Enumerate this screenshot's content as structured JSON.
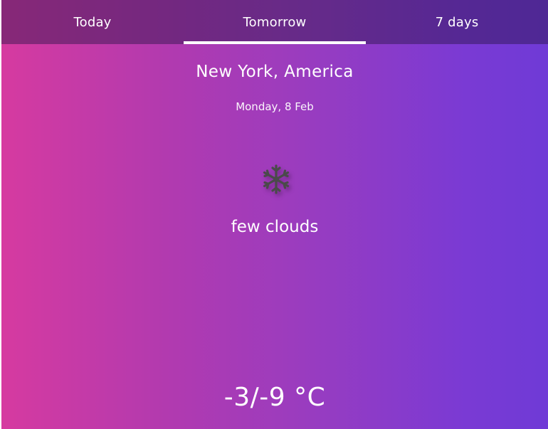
{
  "tabs": [
    {
      "label": "Today",
      "active": false
    },
    {
      "label": "Tomorrow",
      "active": true
    },
    {
      "label": "7 days",
      "active": false
    }
  ],
  "location": "New York, America",
  "date": "Monday, 8 Feb",
  "weather": {
    "icon": "snowflake-icon",
    "description": "few clouds",
    "temperature": "-3/-9 °C"
  },
  "colors": {
    "gradient_start": "#d63aa0",
    "gradient_end": "#6f3ad6",
    "tab_bar": "#4a1f5e"
  }
}
